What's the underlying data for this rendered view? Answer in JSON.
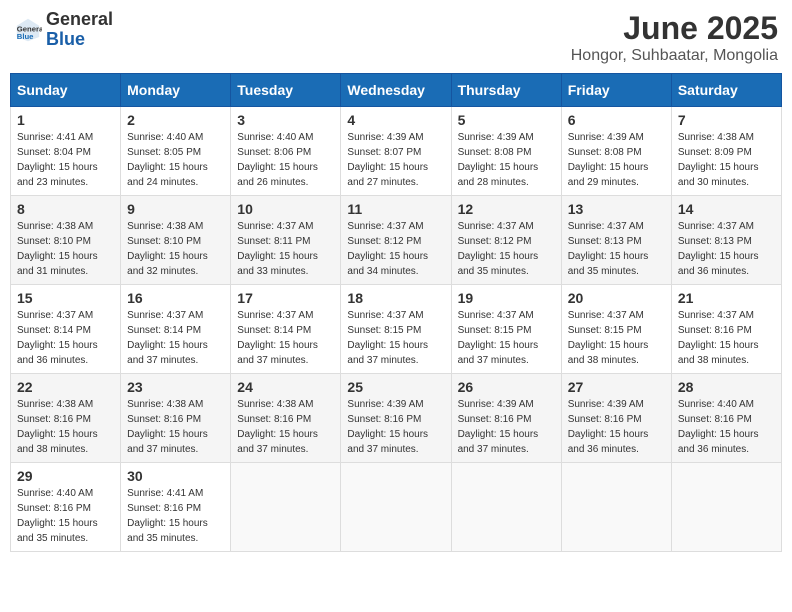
{
  "header": {
    "logo_general": "General",
    "logo_blue": "Blue",
    "main_title": "June 2025",
    "subtitle": "Hongor, Suhbaatar, Mongolia"
  },
  "calendar": {
    "days_of_week": [
      "Sunday",
      "Monday",
      "Tuesday",
      "Wednesday",
      "Thursday",
      "Friday",
      "Saturday"
    ],
    "weeks": [
      [
        null,
        {
          "day": "2",
          "sunrise": "Sunrise: 4:40 AM",
          "sunset": "Sunset: 8:05 PM",
          "daylight": "Daylight: 15 hours and 24 minutes."
        },
        {
          "day": "3",
          "sunrise": "Sunrise: 4:40 AM",
          "sunset": "Sunset: 8:06 PM",
          "daylight": "Daylight: 15 hours and 26 minutes."
        },
        {
          "day": "4",
          "sunrise": "Sunrise: 4:39 AM",
          "sunset": "Sunset: 8:07 PM",
          "daylight": "Daylight: 15 hours and 27 minutes."
        },
        {
          "day": "5",
          "sunrise": "Sunrise: 4:39 AM",
          "sunset": "Sunset: 8:08 PM",
          "daylight": "Daylight: 15 hours and 28 minutes."
        },
        {
          "day": "6",
          "sunrise": "Sunrise: 4:39 AM",
          "sunset": "Sunset: 8:08 PM",
          "daylight": "Daylight: 15 hours and 29 minutes."
        },
        {
          "day": "7",
          "sunrise": "Sunrise: 4:38 AM",
          "sunset": "Sunset: 8:09 PM",
          "daylight": "Daylight: 15 hours and 30 minutes."
        }
      ],
      [
        {
          "day": "1",
          "sunrise": "Sunrise: 4:41 AM",
          "sunset": "Sunset: 8:04 PM",
          "daylight": "Daylight: 15 hours and 23 minutes."
        },
        null,
        null,
        null,
        null,
        null,
        null
      ],
      [
        {
          "day": "8",
          "sunrise": "Sunrise: 4:38 AM",
          "sunset": "Sunset: 8:10 PM",
          "daylight": "Daylight: 15 hours and 31 minutes."
        },
        {
          "day": "9",
          "sunrise": "Sunrise: 4:38 AM",
          "sunset": "Sunset: 8:10 PM",
          "daylight": "Daylight: 15 hours and 32 minutes."
        },
        {
          "day": "10",
          "sunrise": "Sunrise: 4:37 AM",
          "sunset": "Sunset: 8:11 PM",
          "daylight": "Daylight: 15 hours and 33 minutes."
        },
        {
          "day": "11",
          "sunrise": "Sunrise: 4:37 AM",
          "sunset": "Sunset: 8:12 PM",
          "daylight": "Daylight: 15 hours and 34 minutes."
        },
        {
          "day": "12",
          "sunrise": "Sunrise: 4:37 AM",
          "sunset": "Sunset: 8:12 PM",
          "daylight": "Daylight: 15 hours and 35 minutes."
        },
        {
          "day": "13",
          "sunrise": "Sunrise: 4:37 AM",
          "sunset": "Sunset: 8:13 PM",
          "daylight": "Daylight: 15 hours and 35 minutes."
        },
        {
          "day": "14",
          "sunrise": "Sunrise: 4:37 AM",
          "sunset": "Sunset: 8:13 PM",
          "daylight": "Daylight: 15 hours and 36 minutes."
        }
      ],
      [
        {
          "day": "15",
          "sunrise": "Sunrise: 4:37 AM",
          "sunset": "Sunset: 8:14 PM",
          "daylight": "Daylight: 15 hours and 36 minutes."
        },
        {
          "day": "16",
          "sunrise": "Sunrise: 4:37 AM",
          "sunset": "Sunset: 8:14 PM",
          "daylight": "Daylight: 15 hours and 37 minutes."
        },
        {
          "day": "17",
          "sunrise": "Sunrise: 4:37 AM",
          "sunset": "Sunset: 8:14 PM",
          "daylight": "Daylight: 15 hours and 37 minutes."
        },
        {
          "day": "18",
          "sunrise": "Sunrise: 4:37 AM",
          "sunset": "Sunset: 8:15 PM",
          "daylight": "Daylight: 15 hours and 37 minutes."
        },
        {
          "day": "19",
          "sunrise": "Sunrise: 4:37 AM",
          "sunset": "Sunset: 8:15 PM",
          "daylight": "Daylight: 15 hours and 37 minutes."
        },
        {
          "day": "20",
          "sunrise": "Sunrise: 4:37 AM",
          "sunset": "Sunset: 8:15 PM",
          "daylight": "Daylight: 15 hours and 38 minutes."
        },
        {
          "day": "21",
          "sunrise": "Sunrise: 4:37 AM",
          "sunset": "Sunset: 8:16 PM",
          "daylight": "Daylight: 15 hours and 38 minutes."
        }
      ],
      [
        {
          "day": "22",
          "sunrise": "Sunrise: 4:38 AM",
          "sunset": "Sunset: 8:16 PM",
          "daylight": "Daylight: 15 hours and 38 minutes."
        },
        {
          "day": "23",
          "sunrise": "Sunrise: 4:38 AM",
          "sunset": "Sunset: 8:16 PM",
          "daylight": "Daylight: 15 hours and 37 minutes."
        },
        {
          "day": "24",
          "sunrise": "Sunrise: 4:38 AM",
          "sunset": "Sunset: 8:16 PM",
          "daylight": "Daylight: 15 hours and 37 minutes."
        },
        {
          "day": "25",
          "sunrise": "Sunrise: 4:39 AM",
          "sunset": "Sunset: 8:16 PM",
          "daylight": "Daylight: 15 hours and 37 minutes."
        },
        {
          "day": "26",
          "sunrise": "Sunrise: 4:39 AM",
          "sunset": "Sunset: 8:16 PM",
          "daylight": "Daylight: 15 hours and 37 minutes."
        },
        {
          "day": "27",
          "sunrise": "Sunrise: 4:39 AM",
          "sunset": "Sunset: 8:16 PM",
          "daylight": "Daylight: 15 hours and 36 minutes."
        },
        {
          "day": "28",
          "sunrise": "Sunrise: 4:40 AM",
          "sunset": "Sunset: 8:16 PM",
          "daylight": "Daylight: 15 hours and 36 minutes."
        }
      ],
      [
        {
          "day": "29",
          "sunrise": "Sunrise: 4:40 AM",
          "sunset": "Sunset: 8:16 PM",
          "daylight": "Daylight: 15 hours and 35 minutes."
        },
        {
          "day": "30",
          "sunrise": "Sunrise: 4:41 AM",
          "sunset": "Sunset: 8:16 PM",
          "daylight": "Daylight: 15 hours and 35 minutes."
        },
        null,
        null,
        null,
        null,
        null
      ]
    ]
  }
}
